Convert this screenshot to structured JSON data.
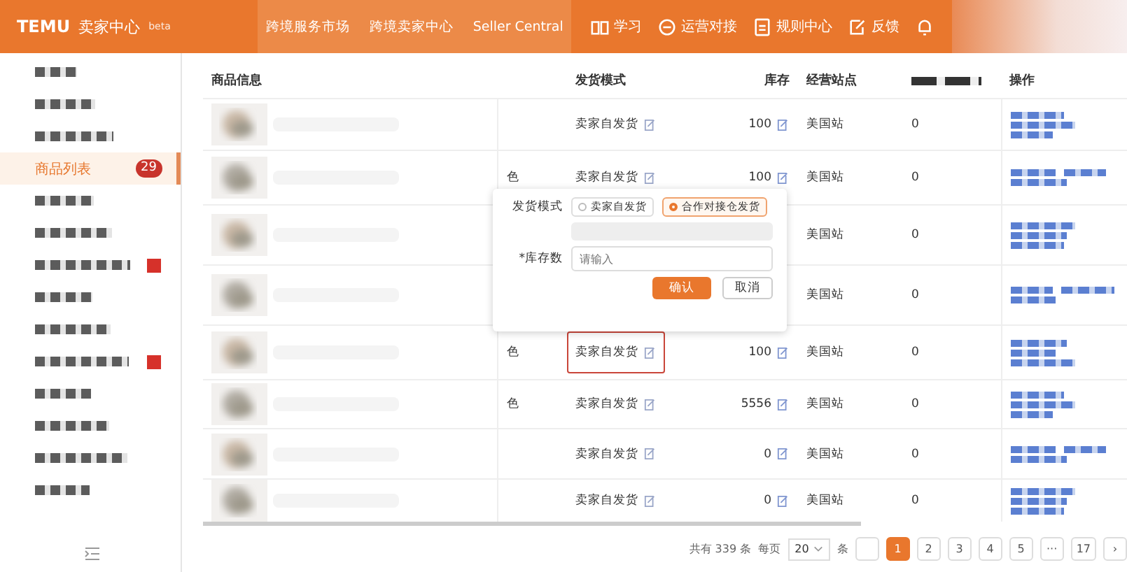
{
  "header": {
    "logo": "TEMU",
    "app_name": "卖家中心",
    "tag": "beta",
    "nav": [
      {
        "label": "跨境服务市场"
      },
      {
        "label": "跨境卖家中心"
      },
      {
        "label": "Seller Central"
      }
    ],
    "tools": [
      {
        "kind": "book",
        "label": "学习"
      },
      {
        "kind": "chat",
        "label": "运营对接"
      },
      {
        "kind": "doc",
        "label": "规则中心"
      },
      {
        "kind": "edit",
        "label": "反馈"
      },
      {
        "kind": "bell"
      }
    ]
  },
  "sidebar": {
    "items": [
      {
        "kind": "redacted",
        "selected": false,
        "red_mark": false
      },
      {
        "kind": "redacted",
        "selected": false,
        "red_mark": false
      },
      {
        "kind": "redacted",
        "selected": false,
        "red_mark": false
      },
      {
        "kind": "item",
        "label": "商品列表",
        "badge": "29",
        "selected": true,
        "red_mark": false
      },
      {
        "kind": "redacted",
        "selected": false,
        "red_mark": false
      },
      {
        "kind": "redacted",
        "selected": false,
        "red_mark": false
      },
      {
        "kind": "redacted",
        "selected": false,
        "red_mark": true
      },
      {
        "kind": "redacted",
        "selected": false,
        "red_mark": false
      },
      {
        "kind": "redacted",
        "selected": false,
        "red_mark": false
      },
      {
        "kind": "redacted",
        "selected": false,
        "red_mark": true
      },
      {
        "kind": "redacted",
        "selected": false,
        "red_mark": false
      },
      {
        "kind": "redacted",
        "selected": false,
        "red_mark": false
      },
      {
        "kind": "redacted",
        "selected": false,
        "red_mark": false
      },
      {
        "kind": "redacted",
        "selected": false,
        "red_mark": false
      }
    ]
  },
  "table": {
    "columns": [
      "商品信息",
      "",
      "发货模式",
      "库存",
      "经营站点",
      "",
      "操作"
    ],
    "rows": [
      {
        "mode": "卖家自发货",
        "stock": "100",
        "site": "美国站",
        "column_6": "0",
        "highlighted": false
      },
      {
        "column_2": "色",
        "mode": "卖家自发货",
        "stock": "100",
        "site": "美国站",
        "column_6": "0",
        "highlighted": false
      },
      {
        "site": "美国站",
        "column_6": "0"
      },
      {
        "site": "美国站",
        "column_6": "0"
      },
      {
        "column_2": "色",
        "mode": "卖家自发货",
        "stock": "100",
        "site": "美国站",
        "column_6": "0",
        "highlighted": true
      },
      {
        "column_2": "色",
        "mode": "卖家自发货",
        "stock": "5556",
        "site": "美国站",
        "column_6": "0",
        "highlighted": false
      },
      {
        "mode": "卖家自发货",
        "stock": "0",
        "site": "美国站",
        "column_6": "0",
        "highlighted": false
      },
      {
        "mode": "卖家自发货",
        "stock": "0",
        "site": "美国站",
        "column_6": "0",
        "highlighted": false
      }
    ]
  },
  "popup": {
    "mode_label": "发货模式",
    "options": [
      {
        "label": "卖家自发货",
        "selected": false
      },
      {
        "label": "合作对接仓发货",
        "selected": true
      }
    ],
    "stock_label": "*库存数",
    "stock_placeholder": "请输入",
    "confirm": "确认",
    "cancel": "取消"
  },
  "pagination": {
    "total": "共有 339 条",
    "per_page_label": "每页",
    "per_page": "20",
    "unit": "条",
    "pages": [
      {
        "label": "1",
        "selected": true
      },
      {
        "label": "2",
        "selected": false
      },
      {
        "label": "3",
        "selected": false
      },
      {
        "label": "4",
        "selected": false
      },
      {
        "label": "5",
        "selected": false
      },
      {
        "label": "···",
        "selected": false
      },
      {
        "label": "17",
        "selected": false
      }
    ],
    "next": "›"
  }
}
